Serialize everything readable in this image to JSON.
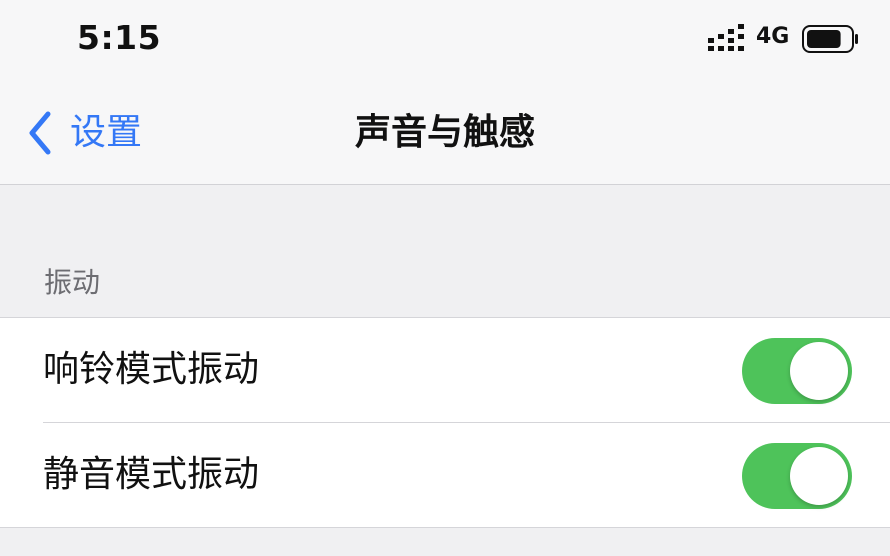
{
  "status_bar": {
    "time": "5:15",
    "network": "4G",
    "battery_level": 0.8
  },
  "nav": {
    "back_label": "设置",
    "title": "声音与触感"
  },
  "vibration_section": {
    "header": "振动",
    "items": [
      {
        "label": "响铃模式振动",
        "on": true
      },
      {
        "label": "静音模式振动",
        "on": true
      }
    ]
  },
  "colors": {
    "accent": "#3478f6",
    "toggle_on": "#4ec35a",
    "background": "#f0f0f2"
  },
  "icons": {
    "signal": "cellular-signal-icon",
    "battery": "battery-icon",
    "back": "chevron-left-icon"
  }
}
